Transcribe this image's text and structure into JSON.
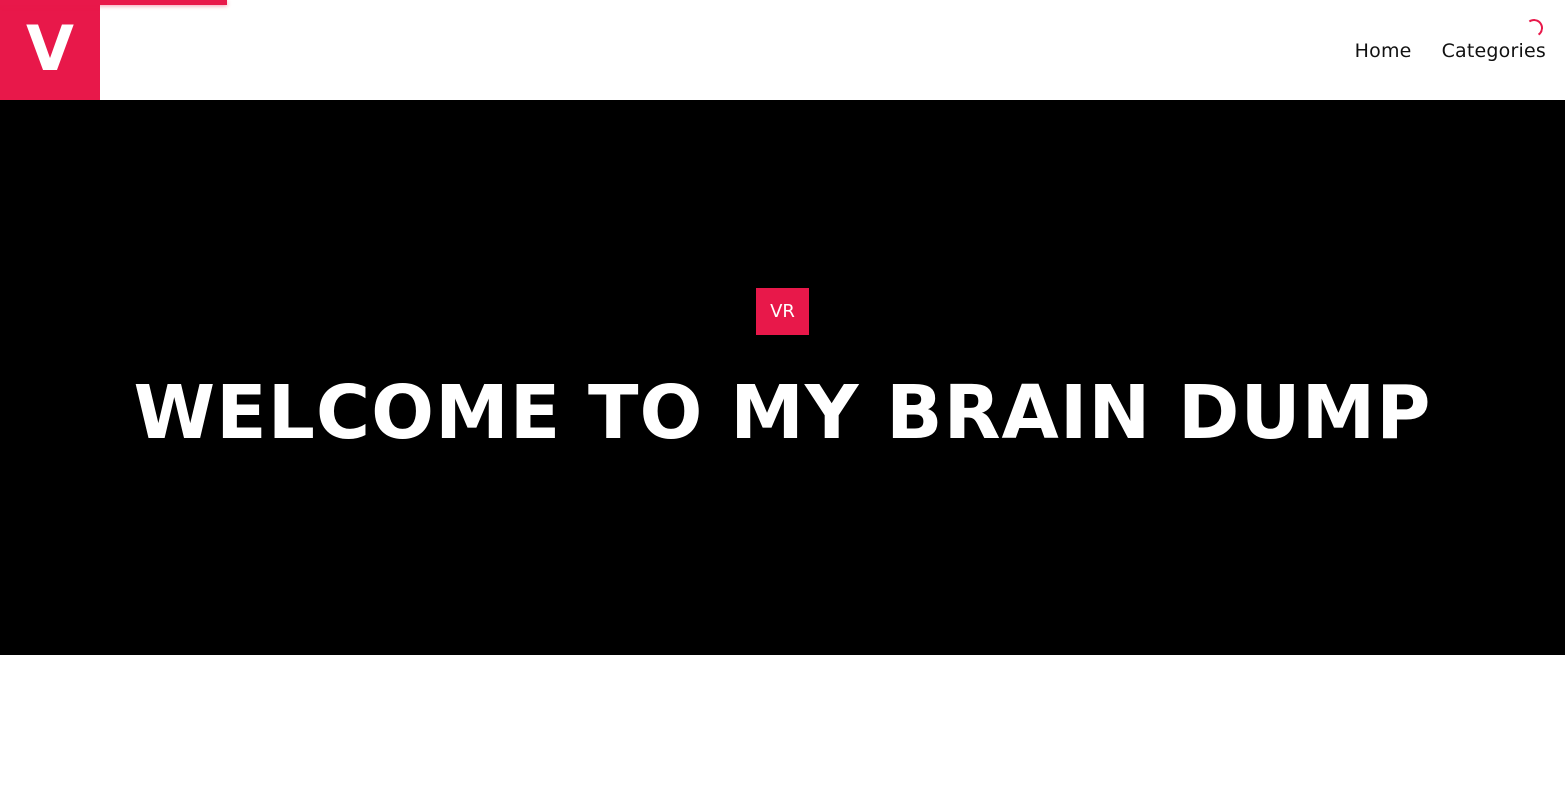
{
  "colors": {
    "accent": "#e8184a",
    "hero_background": "#000000",
    "text_light": "#ffffff",
    "text_dark": "#111111"
  },
  "loading": {
    "progress": 0.145
  },
  "header": {
    "logo": {
      "letter": "V",
      "icon": "site-logo-icon"
    },
    "nav": [
      {
        "label": "Home"
      },
      {
        "label": "Categories"
      }
    ],
    "spinner_icon": "loading-spinner-icon"
  },
  "hero": {
    "category_badge": "VR",
    "title": "WELCOME TO MY BRAIN DUMP"
  }
}
